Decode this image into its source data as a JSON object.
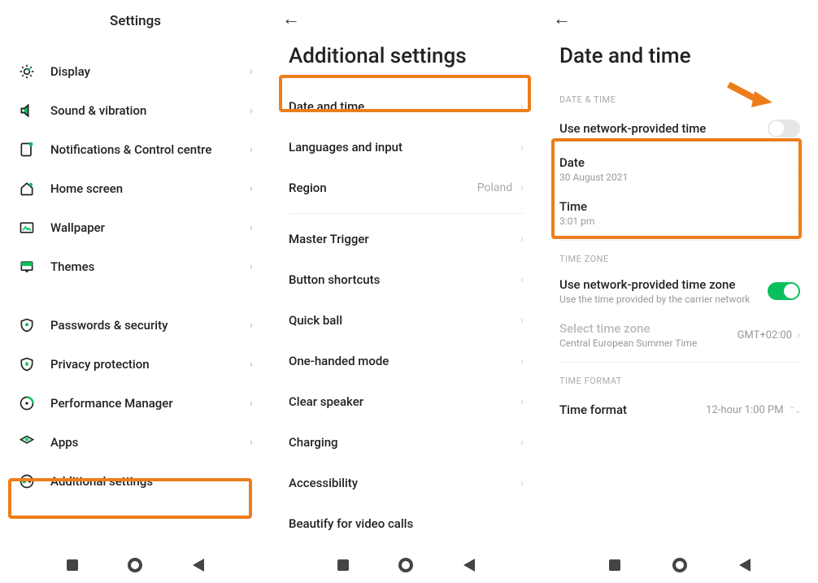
{
  "screen1": {
    "title": "Settings",
    "items": [
      {
        "label": "Display",
        "icon": "display"
      },
      {
        "label": "Sound & vibration",
        "icon": "sound"
      },
      {
        "label": "Notifications & Control centre",
        "icon": "notif"
      },
      {
        "label": "Home screen",
        "icon": "home"
      },
      {
        "label": "Wallpaper",
        "icon": "wallpaper"
      },
      {
        "label": "Themes",
        "icon": "themes"
      }
    ],
    "items2": [
      {
        "label": "Passwords & security",
        "icon": "shield"
      },
      {
        "label": "Privacy protection",
        "icon": "shield2"
      },
      {
        "label": "Performance Manager",
        "icon": "perf"
      },
      {
        "label": "Apps",
        "icon": "apps"
      },
      {
        "label": "Additional settings",
        "icon": "addl"
      }
    ]
  },
  "screen2": {
    "title": "Additional settings",
    "group1": [
      {
        "label": "Date and time",
        "value": ""
      },
      {
        "label": "Languages and input",
        "value": ""
      },
      {
        "label": "Region",
        "value": "Poland"
      }
    ],
    "group2": [
      {
        "label": "Master Trigger"
      },
      {
        "label": "Button shortcuts"
      },
      {
        "label": "Quick ball"
      },
      {
        "label": "One-handed mode"
      },
      {
        "label": "Clear speaker"
      },
      {
        "label": "Charging"
      },
      {
        "label": "Accessibility"
      },
      {
        "label": "Beautify for video calls"
      }
    ]
  },
  "screen3": {
    "title": "Date and time",
    "section_date": "DATE & TIME",
    "row_net_time": "Use network-provided time",
    "date_label": "Date",
    "date_value": "30 August 2021",
    "time_label": "Time",
    "time_value": "3:01 pm",
    "section_tz": "TIME ZONE",
    "row_net_tz": "Use network-provided time zone",
    "row_net_tz_sub": "Use the time provided by the carrier network",
    "sel_tz": "Select time zone",
    "sel_tz_sub": "Central European Summer Time",
    "sel_tz_val": "GMT+02:00",
    "section_fmt": "TIME FORMAT",
    "fmt_label": "Time format",
    "fmt_value": "12-hour 1:00 PM"
  },
  "colors": {
    "accent": "#0bbf5c",
    "highlight": "#ed7d1a"
  }
}
